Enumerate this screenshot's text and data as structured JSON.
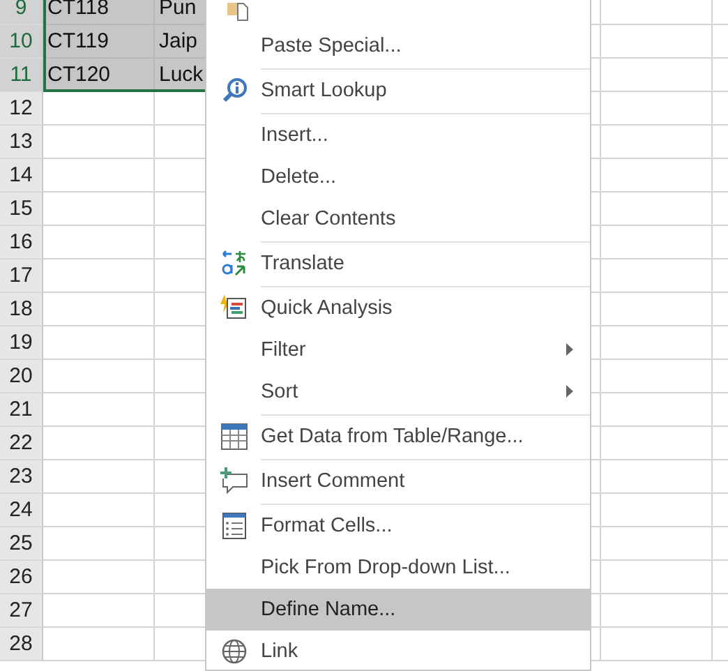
{
  "sheet": {
    "rows": [
      {
        "number": "9",
        "selected": true,
        "cells": [
          "CT118",
          "Pun"
        ]
      },
      {
        "number": "10",
        "selected": true,
        "cells": [
          "CT119",
          "Jaip"
        ]
      },
      {
        "number": "11",
        "selected": true,
        "cells": [
          "CT120",
          "Luck"
        ]
      },
      {
        "number": "12",
        "selected": false,
        "cells": []
      },
      {
        "number": "13",
        "selected": false,
        "cells": []
      },
      {
        "number": "14",
        "selected": false,
        "cells": []
      },
      {
        "number": "15",
        "selected": false,
        "cells": []
      },
      {
        "number": "16",
        "selected": false,
        "cells": []
      },
      {
        "number": "17",
        "selected": false,
        "cells": []
      },
      {
        "number": "18",
        "selected": false,
        "cells": []
      },
      {
        "number": "19",
        "selected": false,
        "cells": []
      },
      {
        "number": "20",
        "selected": false,
        "cells": []
      },
      {
        "number": "21",
        "selected": false,
        "cells": []
      },
      {
        "number": "22",
        "selected": false,
        "cells": []
      },
      {
        "number": "23",
        "selected": false,
        "cells": []
      },
      {
        "number": "24",
        "selected": false,
        "cells": []
      },
      {
        "number": "25",
        "selected": false,
        "cells": []
      },
      {
        "number": "26",
        "selected": false,
        "cells": []
      },
      {
        "number": "27",
        "selected": false,
        "cells": []
      },
      {
        "number": "28",
        "selected": false,
        "cells": []
      }
    ]
  },
  "context_menu": {
    "items": [
      {
        "kind": "paste",
        "selected": false
      },
      {
        "kind": "item",
        "label": "Paste Special...",
        "selected": false
      },
      {
        "kind": "separator"
      },
      {
        "kind": "lookup",
        "label": "Smart Lookup",
        "selected": false
      },
      {
        "kind": "separator"
      },
      {
        "kind": "item",
        "label": "Insert...",
        "selected": false
      },
      {
        "kind": "item",
        "label": "Delete...",
        "selected": false
      },
      {
        "kind": "item",
        "label": "Clear Contents",
        "selected": false
      },
      {
        "kind": "separator"
      },
      {
        "kind": "translate",
        "label": "Translate",
        "selected": false
      },
      {
        "kind": "separator"
      },
      {
        "kind": "analysis",
        "label": "Quick Analysis",
        "selected": false
      },
      {
        "kind": "submenu",
        "label": "Filter",
        "selected": false
      },
      {
        "kind": "submenu",
        "label": "Sort",
        "selected": false
      },
      {
        "kind": "separator"
      },
      {
        "kind": "table",
        "label": "Get Data from Table/Range...",
        "selected": false
      },
      {
        "kind": "separator"
      },
      {
        "kind": "comment",
        "label": "Insert Comment",
        "selected": false
      },
      {
        "kind": "separator"
      },
      {
        "kind": "format",
        "label": "Format Cells...",
        "selected": false
      },
      {
        "kind": "item",
        "label": "Pick From Drop-down List...",
        "selected": false
      },
      {
        "kind": "item",
        "label": "Define Name...",
        "selected": true
      },
      {
        "kind": "link",
        "label": "Link",
        "selected": false
      }
    ]
  }
}
